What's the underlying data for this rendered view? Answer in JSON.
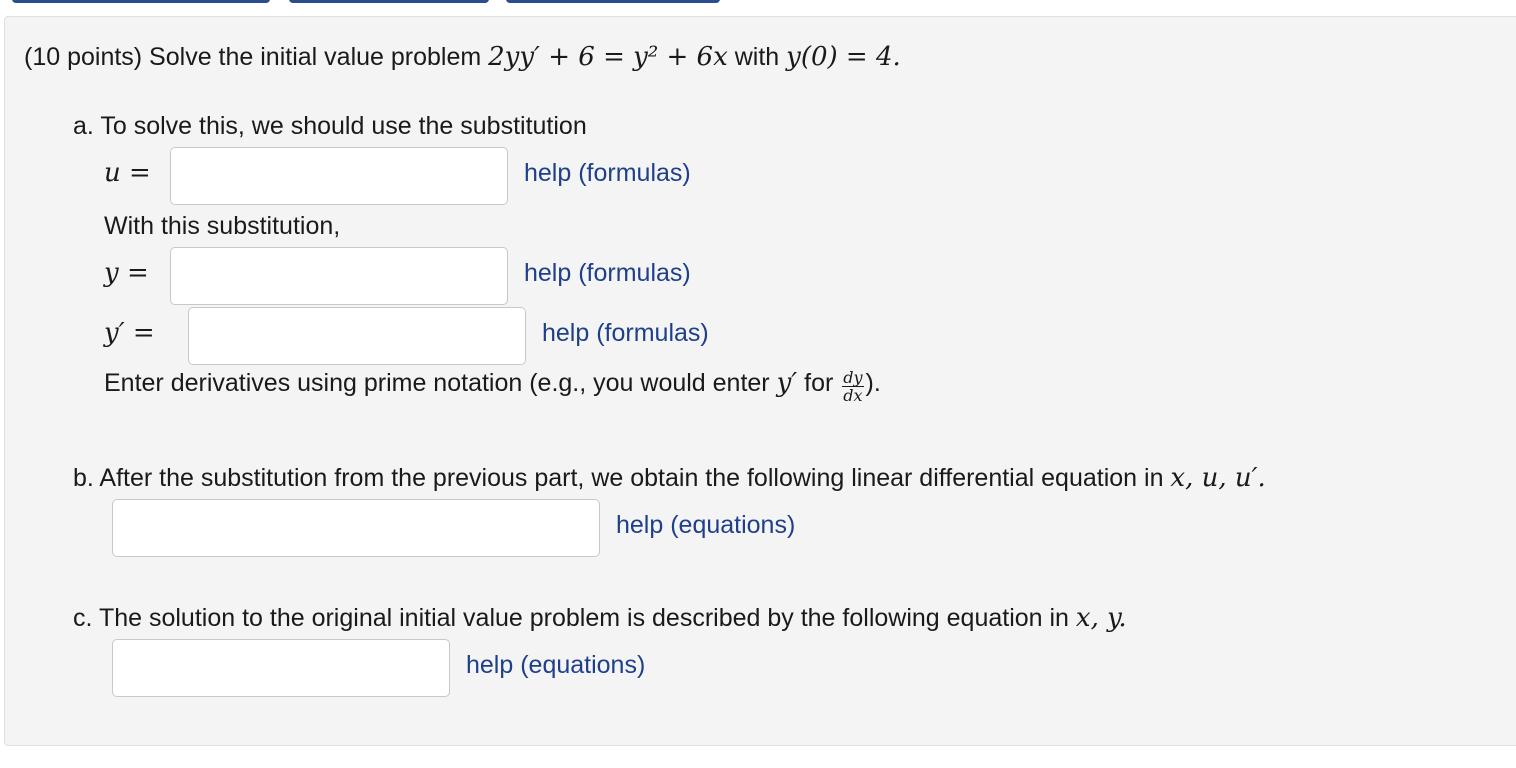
{
  "problem": {
    "intro": "(10 points) Solve the initial value problem ",
    "equation": "2yy′ + 6 = y² + 6x",
    "with_text": " with ",
    "condition": "y(0) = 4."
  },
  "part_a": {
    "prompt": "a. To solve this, we should use the substitution",
    "u_label": "u =",
    "with_sub": "With this substitution,",
    "y_label": "y =",
    "yprime_label": "y′ =",
    "note_start": "Enter derivatives using prime notation (e.g., you would enter ",
    "note_y": "y′",
    "note_for": " for ",
    "frac_num": "dy",
    "frac_den": "dx",
    "note_end": ").",
    "inputs": {
      "u_value": "",
      "y_value": "",
      "yprime_value": ""
    },
    "help_u": "help (formulas)",
    "help_y": "help (formulas)",
    "help_yprime": "help (formulas)"
  },
  "part_b": {
    "prompt": "b. After the substitution from the previous part, we obtain the following linear differential equation in ",
    "vars": "x, u, u′.",
    "input_value": "",
    "help": "help (equations)"
  },
  "part_c": {
    "prompt": "c. The solution to the original initial value problem is described by the following equation in ",
    "vars": "x, y.",
    "input_value": "",
    "help": "help (equations)"
  }
}
